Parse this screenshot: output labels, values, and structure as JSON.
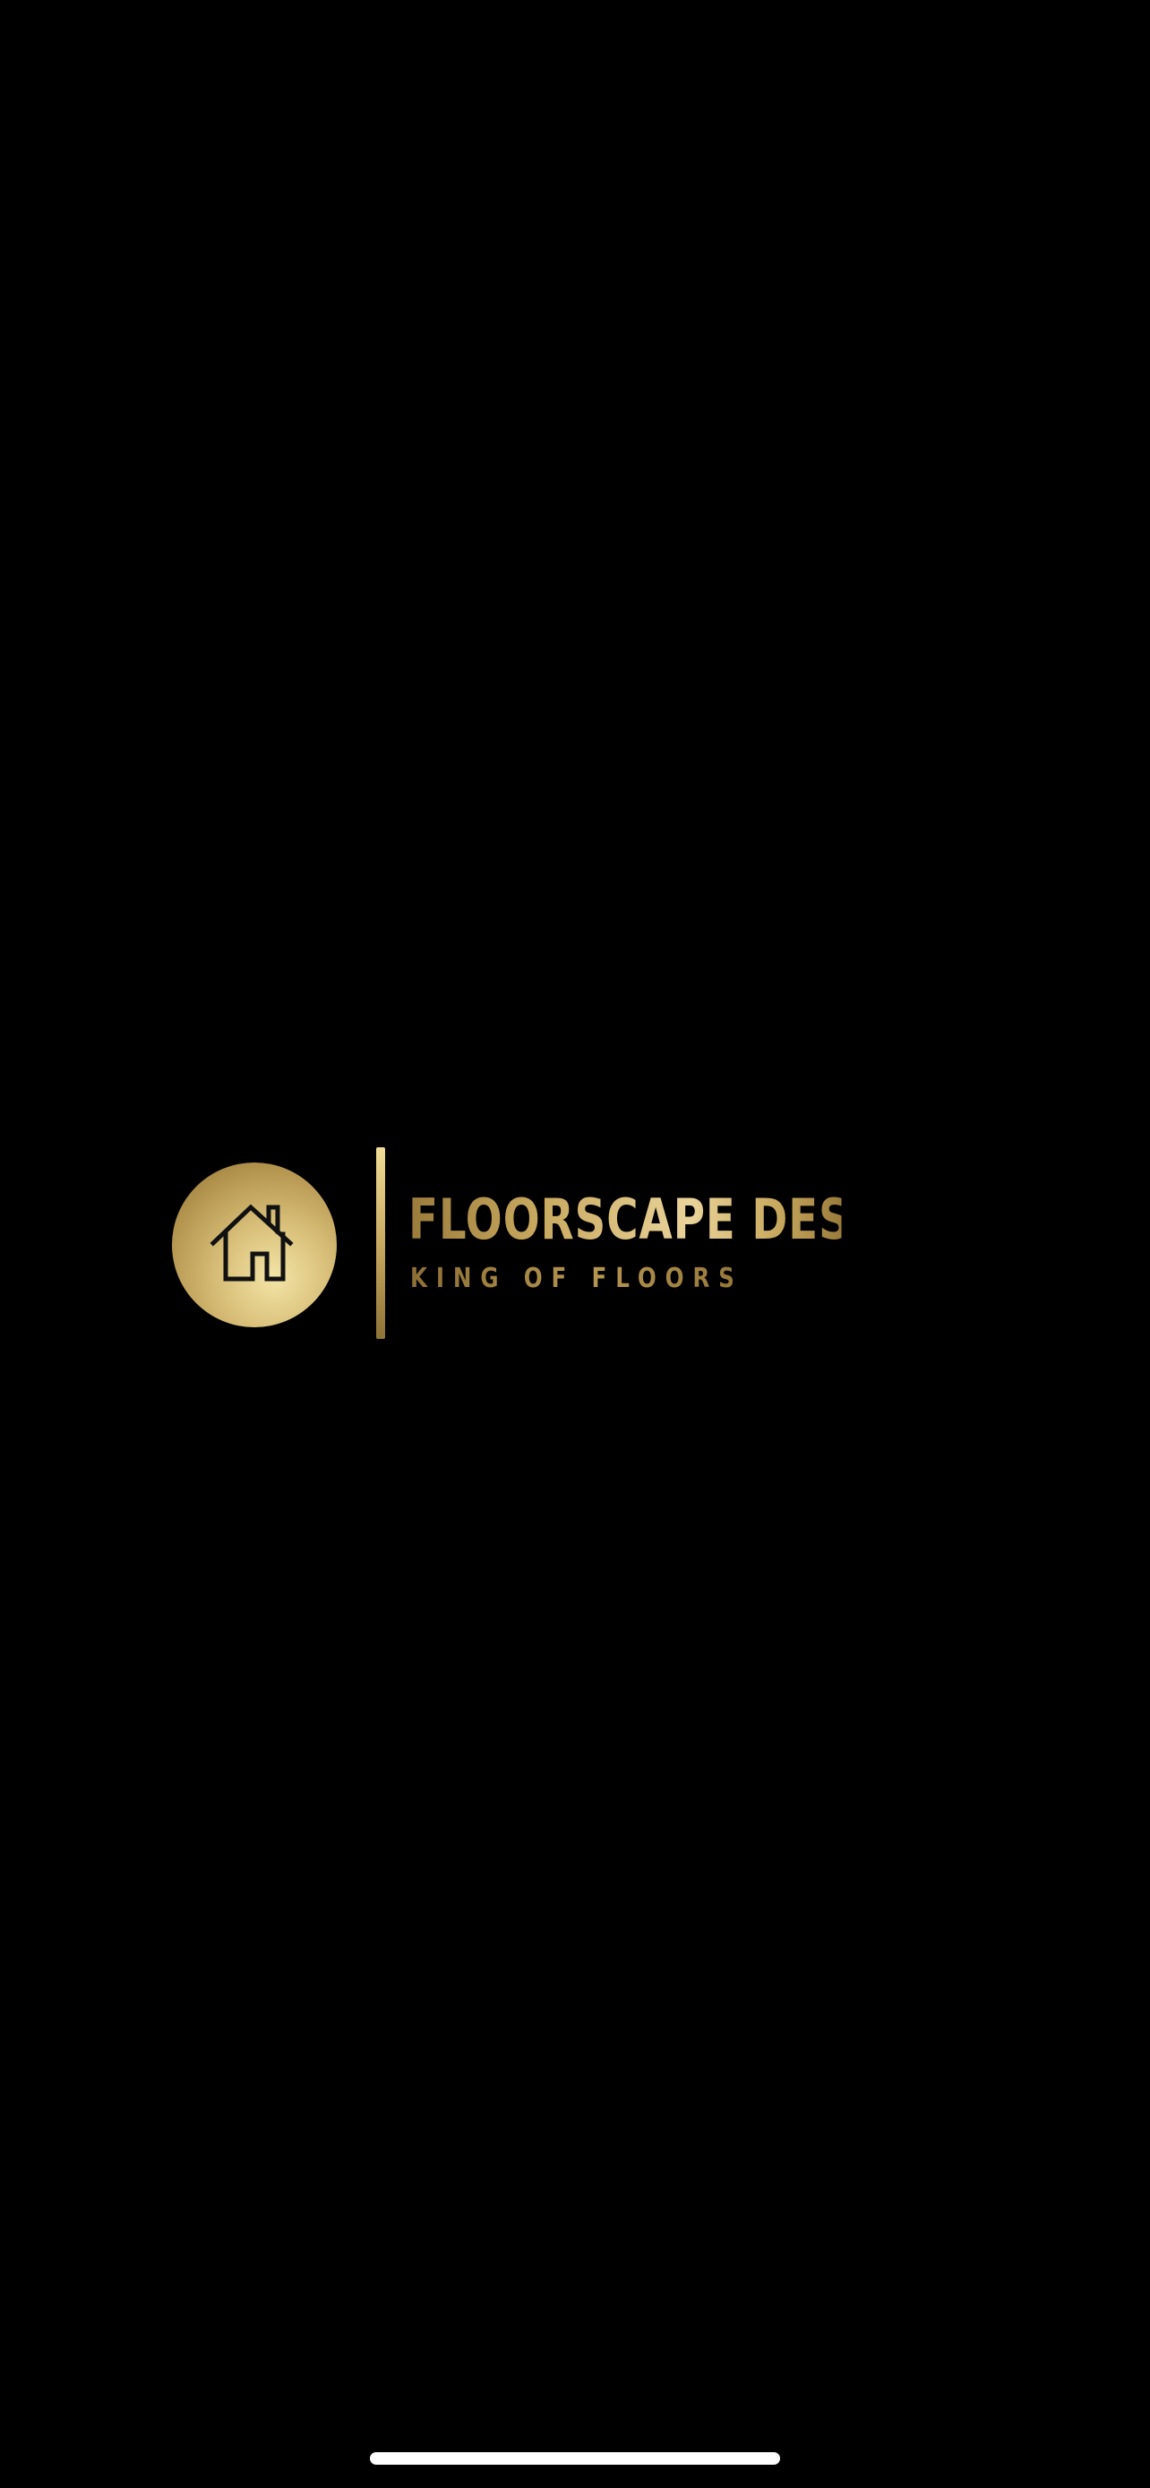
{
  "splash": {
    "brand_name": "FLOORSCAPE DESIGN",
    "tagline": "KING OF FLOORS",
    "emblem_icon": "house-icon"
  },
  "colors": {
    "background": "#000000",
    "gold_light": "#ead39a",
    "gold_mid": "#c8a95f",
    "gold_dark": "#8d6f34",
    "home_indicator": "#ffffff"
  }
}
